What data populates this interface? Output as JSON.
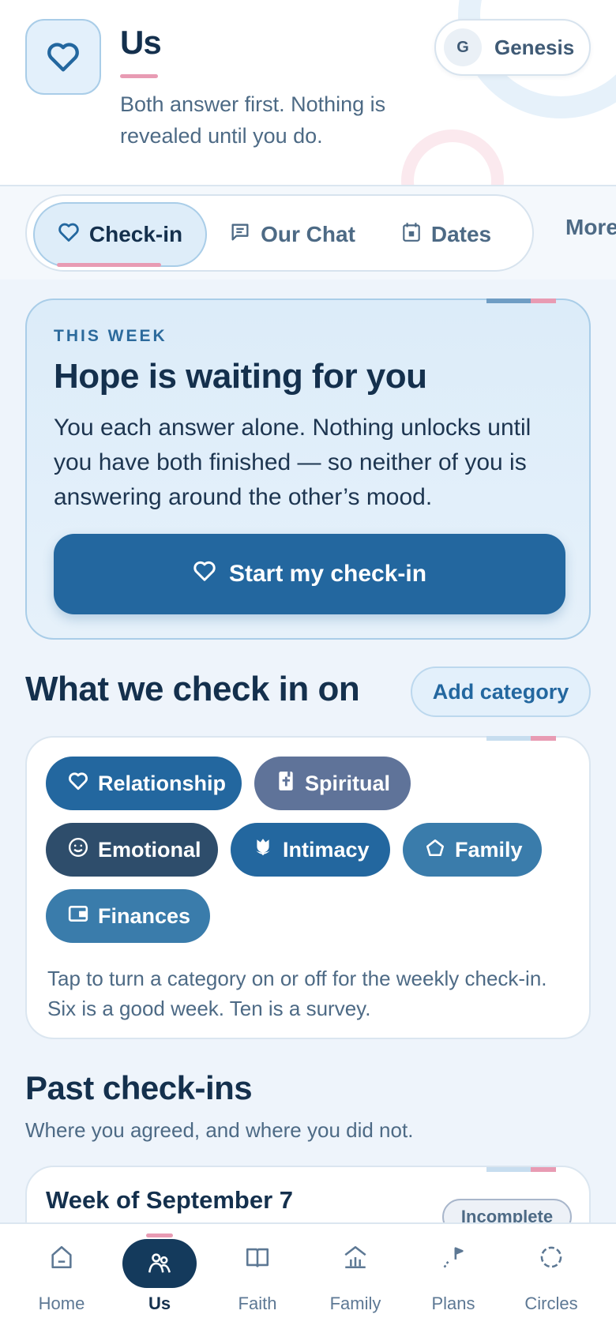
{
  "header": {
    "title": "Us",
    "subtitle": "Both answer first. Nothing is revealed until you do.",
    "profile": {
      "initial": "G",
      "name": "Genesis"
    }
  },
  "tabs": [
    {
      "label": "Check-in",
      "icon": "heart-icon",
      "active": true
    },
    {
      "label": "Our Chat",
      "icon": "chat-icon",
      "active": false
    },
    {
      "label": "Dates",
      "icon": "calendar-icon",
      "active": false
    },
    {
      "label": "More",
      "icon": "",
      "active": false
    }
  ],
  "hero": {
    "eyebrow": "THIS WEEK",
    "title": "Hope is waiting for you",
    "body": "You each answer alone. Nothing unlocks until you have both finished — so neither of you is answering around the other’s mood.",
    "button_label": "Start my check-in"
  },
  "categories_section": {
    "title": "What we check in on",
    "add_label": "Add category",
    "chips": [
      {
        "label": "Relationship",
        "icon": "heart-icon",
        "color": "#23679f"
      },
      {
        "label": "Spiritual",
        "icon": "bible-icon",
        "color": "#5f7399"
      },
      {
        "label": "Emotional",
        "icon": "smiley-icon",
        "color": "#2e4d6b"
      },
      {
        "label": "Intimacy",
        "icon": "flower-icon",
        "color": "#23679f"
      },
      {
        "label": "Family",
        "icon": "home-icon",
        "color": "#3a7cab"
      },
      {
        "label": "Finances",
        "icon": "wallet-icon",
        "color": "#3a7cab"
      }
    ],
    "note": "Tap to turn a category on or off for the weekly check-in. Six is a good week. Ten is a survey."
  },
  "past_section": {
    "title": "Past check-ins",
    "subtitle": "Where you agreed, and where you did not.",
    "weeks": [
      {
        "title": "Week of September 7",
        "status": "Incomplete"
      }
    ]
  },
  "bottom_nav": [
    {
      "label": "Home",
      "icon": "home-icon",
      "active": false
    },
    {
      "label": "Us",
      "icon": "couple-icon",
      "active": true
    },
    {
      "label": "Faith",
      "icon": "book-icon",
      "active": false
    },
    {
      "label": "Family",
      "icon": "family-house-icon",
      "active": false
    },
    {
      "label": "Plans",
      "icon": "flag-path-icon",
      "active": false
    },
    {
      "label": "Circles",
      "icon": "circle-icon",
      "active": false
    }
  ],
  "colors": {
    "primary": "#23679f",
    "navy": "#14304d",
    "accent_pink": "#e89bb3",
    "background": "#eef4fb"
  }
}
